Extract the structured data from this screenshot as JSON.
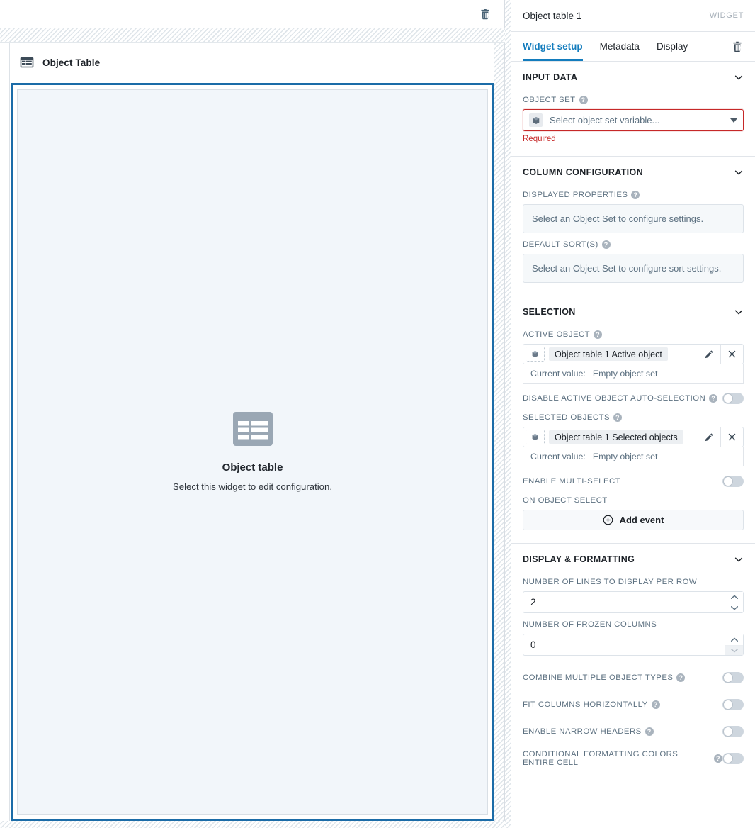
{
  "canvas": {
    "toolbar": {
      "delete_icon": "trash-icon"
    },
    "widget_header": {
      "title": "Object Table",
      "icon": "table-icon"
    },
    "placeholder": {
      "icon": "table-icon",
      "title": "Object table",
      "subtitle": "Select this widget to edit configuration."
    }
  },
  "panel": {
    "title": "Object table 1",
    "kind": "WIDGET",
    "delete_icon": "trash-icon",
    "tabs": [
      {
        "label": "Widget setup",
        "active": true
      },
      {
        "label": "Metadata",
        "active": false
      },
      {
        "label": "Display",
        "active": false
      }
    ],
    "sections": {
      "input_data": {
        "title": "INPUT DATA",
        "object_set": {
          "label": "OBJECT SET",
          "placeholder": "Select object set variable...",
          "icon": "object-set-icon",
          "error": "Required"
        }
      },
      "column_configuration": {
        "title": "COLUMN CONFIGURATION",
        "displayed_properties": {
          "label": "DISPLAYED PROPERTIES",
          "value": "Select an Object Set to configure settings."
        },
        "default_sorts": {
          "label": "DEFAULT SORT(S)",
          "value": "Select an Object Set to configure sort settings."
        }
      },
      "selection": {
        "title": "SELECTION",
        "active_object": {
          "label": "ACTIVE OBJECT",
          "variable": "Object table 1 Active object",
          "current_value_label": "Current value:",
          "current_value": "Empty object set",
          "edit_icon": "pencil-icon",
          "clear_icon": "close-icon"
        },
        "disable_auto_selection": {
          "label": "DISABLE ACTIVE OBJECT AUTO-SELECTION",
          "value": "off"
        },
        "selected_objects": {
          "label": "SELECTED OBJECTS",
          "variable": "Object table 1 Selected objects",
          "current_value_label": "Current value:",
          "current_value": "Empty object set",
          "edit_icon": "pencil-icon",
          "clear_icon": "close-icon"
        },
        "enable_multi_select": {
          "label": "ENABLE MULTI-SELECT",
          "value": "off"
        },
        "on_object_select": {
          "label": "ON OBJECT SELECT",
          "add_event_label": "Add event"
        }
      },
      "display_formatting": {
        "title": "DISPLAY & FORMATTING",
        "lines_per_row": {
          "label": "NUMBER OF LINES TO DISPLAY PER ROW",
          "value": "2"
        },
        "frozen_columns": {
          "label": "NUMBER OF FROZEN COLUMNS",
          "value": "0"
        },
        "combine_object_types": {
          "label": "COMBINE MULTIPLE OBJECT TYPES",
          "value": "off"
        },
        "fit_columns": {
          "label": "FIT COLUMNS HORIZONTALLY",
          "value": "off"
        },
        "narrow_headers": {
          "label": "ENABLE NARROW HEADERS",
          "value": "off"
        },
        "conditional_formatting": {
          "label": "CONDITIONAL FORMATTING COLORS ENTIRE CELL",
          "value": "off"
        }
      }
    }
  },
  "colors": {
    "accent": "#137cbd",
    "selection_border": "#1b6ca8",
    "error": "#c62828",
    "label": "#5c7080",
    "placeholder_bg": "#f2f6fa"
  }
}
